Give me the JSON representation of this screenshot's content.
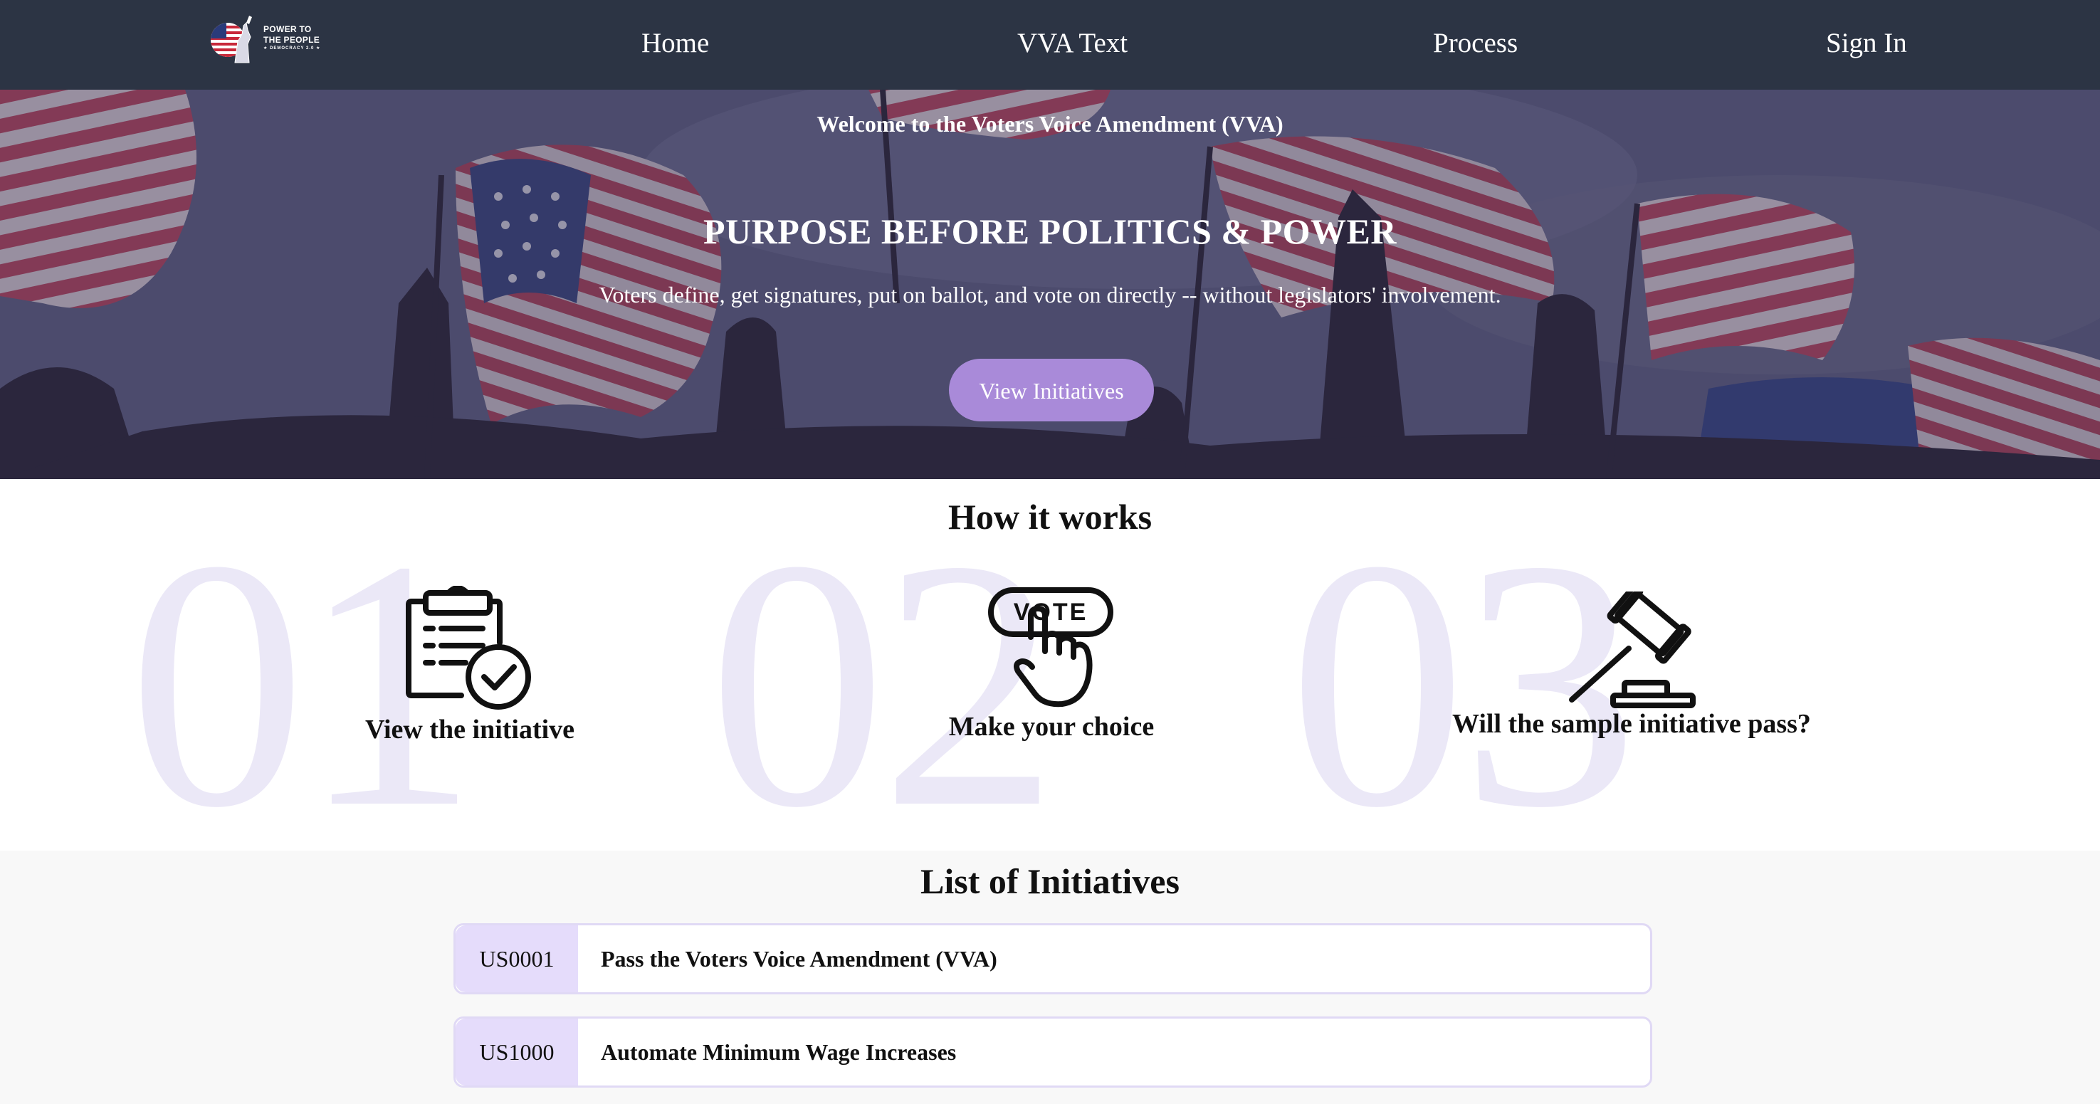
{
  "nav": {
    "logo_line1": "POWER TO",
    "logo_line2": "THE PEOPLE",
    "logo_line3": "★ DEMOCRACY 2.0 ★",
    "items": [
      "Home",
      "VVA Text",
      "Process",
      "Sign In"
    ]
  },
  "hero": {
    "welcome": "Welcome to the Voters Voice Amendment (VVA)",
    "headline": "PURPOSE BEFORE POLITICS & POWER",
    "subline": "Voters define, get signatures, put on ballot, and vote on directly -- without legislators' involvement.",
    "cta": "View Initiatives"
  },
  "how_it_works": {
    "title": "How it works",
    "steps": [
      {
        "number": "01",
        "label": "View the initiative",
        "icon": "clipboard-check-icon"
      },
      {
        "number": "02",
        "label": "Make your choice",
        "icon": "vote-hand-icon",
        "icon_text": "VOTE"
      },
      {
        "number": "03",
        "label": "Will the sample initiative pass?",
        "icon": "gavel-icon"
      }
    ]
  },
  "initiatives": {
    "title": "List of Initiatives",
    "items": [
      {
        "code": "US0001",
        "title": "Pass the Voters Voice Amendment (VVA)"
      },
      {
        "code": "US1000",
        "title": "Automate Minimum Wage Increases"
      }
    ]
  },
  "colors": {
    "nav_bg": "#2c3444",
    "accent": "#a98ad9",
    "code_bg": "#e5dcfb",
    "bignum": "#ebe8f7"
  }
}
